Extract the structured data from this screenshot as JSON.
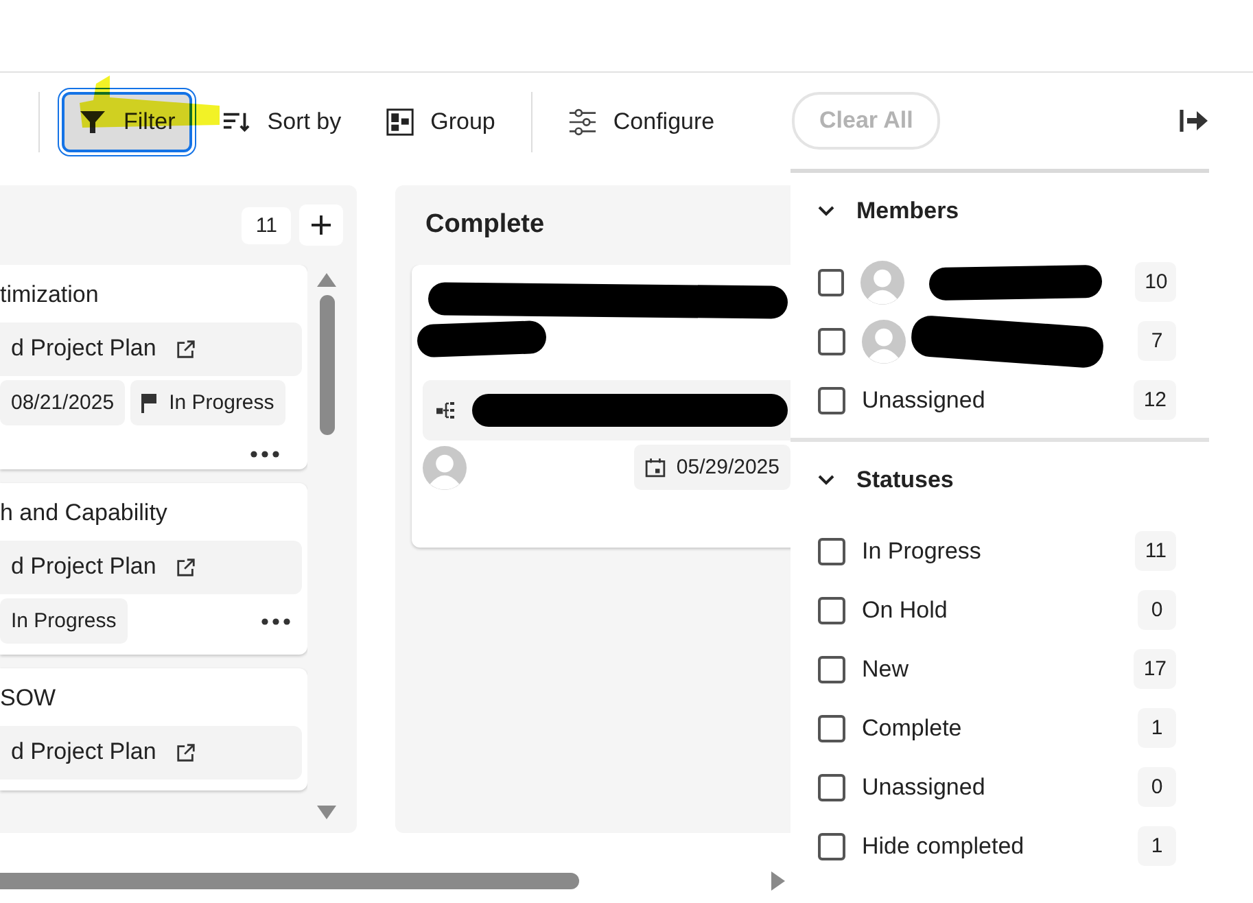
{
  "toolbar": {
    "items": [
      {
        "kind": "filter",
        "label": "Filter",
        "selected": true
      },
      {
        "kind": "sort",
        "label": "Sort by",
        "selected": false
      },
      {
        "kind": "group",
        "label": "Group",
        "selected": false
      },
      {
        "kind": "configure",
        "label": "Configure",
        "selected": false
      }
    ]
  },
  "board": {
    "columns": [
      {
        "count": "11",
        "cards": [
          {
            "kind": "task",
            "title": "timization",
            "link": "d Project Plan",
            "date": "08/21/2025",
            "status": "In Progress",
            "status_flag": true
          },
          {
            "kind": "task",
            "title": "h and Capability",
            "link": "d Project Plan",
            "status": "In Progress",
            "status_flag": false
          },
          {
            "kind": "task",
            "title": "SOW",
            "link": "d Project Plan"
          }
        ]
      },
      {
        "title": "Complete",
        "cards": [
          {
            "kind": "redacted",
            "date": "05/29/2025"
          }
        ]
      }
    ]
  },
  "filter_panel": {
    "clear_button": "Clear All",
    "sections": [
      {
        "title": "Members",
        "expanded": true,
        "options": [
          {
            "kind": "member",
            "count": "10",
            "checked": false
          },
          {
            "kind": "member",
            "count": "7",
            "checked": false
          },
          {
            "kind": "plain",
            "label": "Unassigned",
            "count": "12",
            "checked": false
          }
        ]
      },
      {
        "title": "Statuses",
        "expanded": true,
        "options": [
          {
            "kind": "plain",
            "label": "In Progress",
            "count": "11",
            "checked": false
          },
          {
            "kind": "plain",
            "label": "On Hold",
            "count": "0",
            "checked": false
          },
          {
            "kind": "plain",
            "label": "New",
            "count": "17",
            "checked": false
          },
          {
            "kind": "plain",
            "label": "Complete",
            "count": "1",
            "checked": false
          },
          {
            "kind": "plain",
            "label": "Unassigned",
            "count": "0",
            "checked": false
          },
          {
            "kind": "plain",
            "label": "Hide completed",
            "count": "1",
            "checked": false
          }
        ]
      }
    ]
  }
}
